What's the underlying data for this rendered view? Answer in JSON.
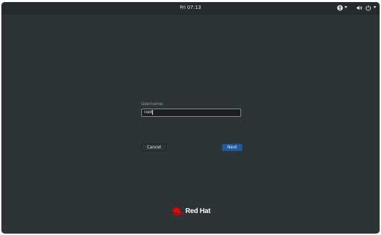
{
  "topbar": {
    "clock": "Fri 07:13",
    "icons": [
      "accessibility-icon",
      "chevron-down-icon",
      "volume-icon",
      "power-icon",
      "chevron-down-icon"
    ]
  },
  "login": {
    "username_label": "Username:",
    "username_value": "root",
    "cancel_label": "Cancel",
    "next_label": "Next"
  },
  "brand": {
    "name": "Red Hat",
    "logo_color": "#ee0000"
  },
  "colors": {
    "background": "#2e3436",
    "topbar": "#262b2d",
    "accent": "#215d9c"
  }
}
